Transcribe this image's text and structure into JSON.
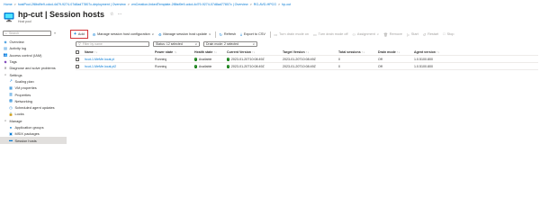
{
  "breadcrumb": [
    "Home",
    "hostPool-2f8bd9e9-cdcd-4d79-9274-07d8ad77807c-deployment | Overview",
    "vmCreation-linkedTemplate-2f8bd9e9-cdcd-4d79-9274-07d8ad77807c | Overview",
    "RG-AVD-HPCG",
    "hp-cut"
  ],
  "header": {
    "title": "hp-cut | Session hosts",
    "subtitle": "Host pool",
    "pin_glyph": "☆",
    "more_glyph": "···"
  },
  "sidebar": {
    "search_placeholder": "Search",
    "collapse_glyph": "«",
    "items": [
      {
        "label": "Overview",
        "icon": "overview-icon",
        "glyph": "◈",
        "color": "#0078d4"
      },
      {
        "label": "Activity log",
        "icon": "activity-log-icon",
        "glyph": "▤",
        "color": "#0078d4"
      },
      {
        "label": "Access control (IAM)",
        "icon": "iam-icon",
        "glyph": "👥",
        "color": "#0078d4"
      },
      {
        "label": "Tags",
        "icon": "tag-icon",
        "glyph": "◆",
        "color": "#7a3fb8"
      },
      {
        "label": "Diagnose and solve problems",
        "icon": "wrench-icon",
        "glyph": "✕",
        "color": "#605e5c"
      },
      {
        "label": "Settings",
        "icon": "chevron-down-icon",
        "glyph": "∨",
        "color": "#605e5c",
        "group": true
      },
      {
        "label": "Scaling plan",
        "icon": "scaling-plan-icon",
        "glyph": "↗",
        "color": "#0078d4",
        "sub": true
      },
      {
        "label": "VM properties",
        "icon": "vm-properties-icon",
        "glyph": "▦",
        "color": "#0078d4",
        "sub": true
      },
      {
        "label": "Properties",
        "icon": "properties-icon",
        "glyph": "▥",
        "color": "#0078d4",
        "sub": true
      },
      {
        "label": "Networking",
        "icon": "networking-icon",
        "glyph": "▩",
        "color": "#0078d4",
        "sub": true
      },
      {
        "label": "Scheduled agent updates",
        "icon": "clock-icon",
        "glyph": "◷",
        "color": "#0078d4",
        "sub": true
      },
      {
        "label": "Locks",
        "icon": "lock-icon",
        "glyph": "🔒",
        "color": "#0078d4",
        "sub": true
      },
      {
        "label": "Manage",
        "icon": "chevron-down-icon",
        "glyph": "∨",
        "color": "#605e5c",
        "group": true
      },
      {
        "label": "Application groups",
        "icon": "app-groups-icon",
        "glyph": "●",
        "color": "#0078d4",
        "sub": true
      },
      {
        "label": "MSIX packages",
        "icon": "msix-icon",
        "glyph": "▣",
        "color": "#0078d4",
        "sub": true
      },
      {
        "label": "Session hosts",
        "icon": "session-hosts-icon",
        "glyph": "▬",
        "color": "#0078d4",
        "sub": true,
        "active": true
      }
    ]
  },
  "toolbar": {
    "add": "Add",
    "manage_config": "Manage session host configuration",
    "manage_update": "Manage session host update",
    "refresh": "Refresh",
    "export_csv": "Export to CSV",
    "turn_drain_on": "Turn drain mode on",
    "turn_drain_off": "Turn drain mode off",
    "assignment": "Assignment",
    "remove": "Remove",
    "start": "Start",
    "restart": "Restart",
    "stop": "Stop"
  },
  "filters": {
    "name_placeholder": "Filter by name",
    "status": "Status: 12 selected",
    "drain": "Drain mode: 2 selected"
  },
  "table": {
    "columns": [
      "Name",
      "Power state",
      "Health state",
      "Current Version",
      "Target Version",
      "Total sessions",
      "Drain mode",
      "Agent version"
    ],
    "rows": [
      {
        "name": "hcut-1.MeMe.local.pl",
        "power": "Running",
        "health": "Available",
        "current": "2023-01-20T10:08:49Z",
        "target": "2023-01-20T10:08:49Z",
        "sessions": "0",
        "drain": "Off",
        "agent": "1.0.5100.800"
      },
      {
        "name": "hcut-1.MeMe.local.pl2",
        "power": "Running",
        "health": "Available",
        "current": "2023-01-20T10:08:49Z",
        "target": "2023-01-20T10:08:49Z",
        "sessions": "0",
        "drain": "Off",
        "agent": "1.0.5100.800"
      }
    ]
  },
  "colors": {
    "accent": "#0078d4",
    "available": "#107c10",
    "add_highlight": "#d13438",
    "active_nav": "#e1dfdd"
  }
}
